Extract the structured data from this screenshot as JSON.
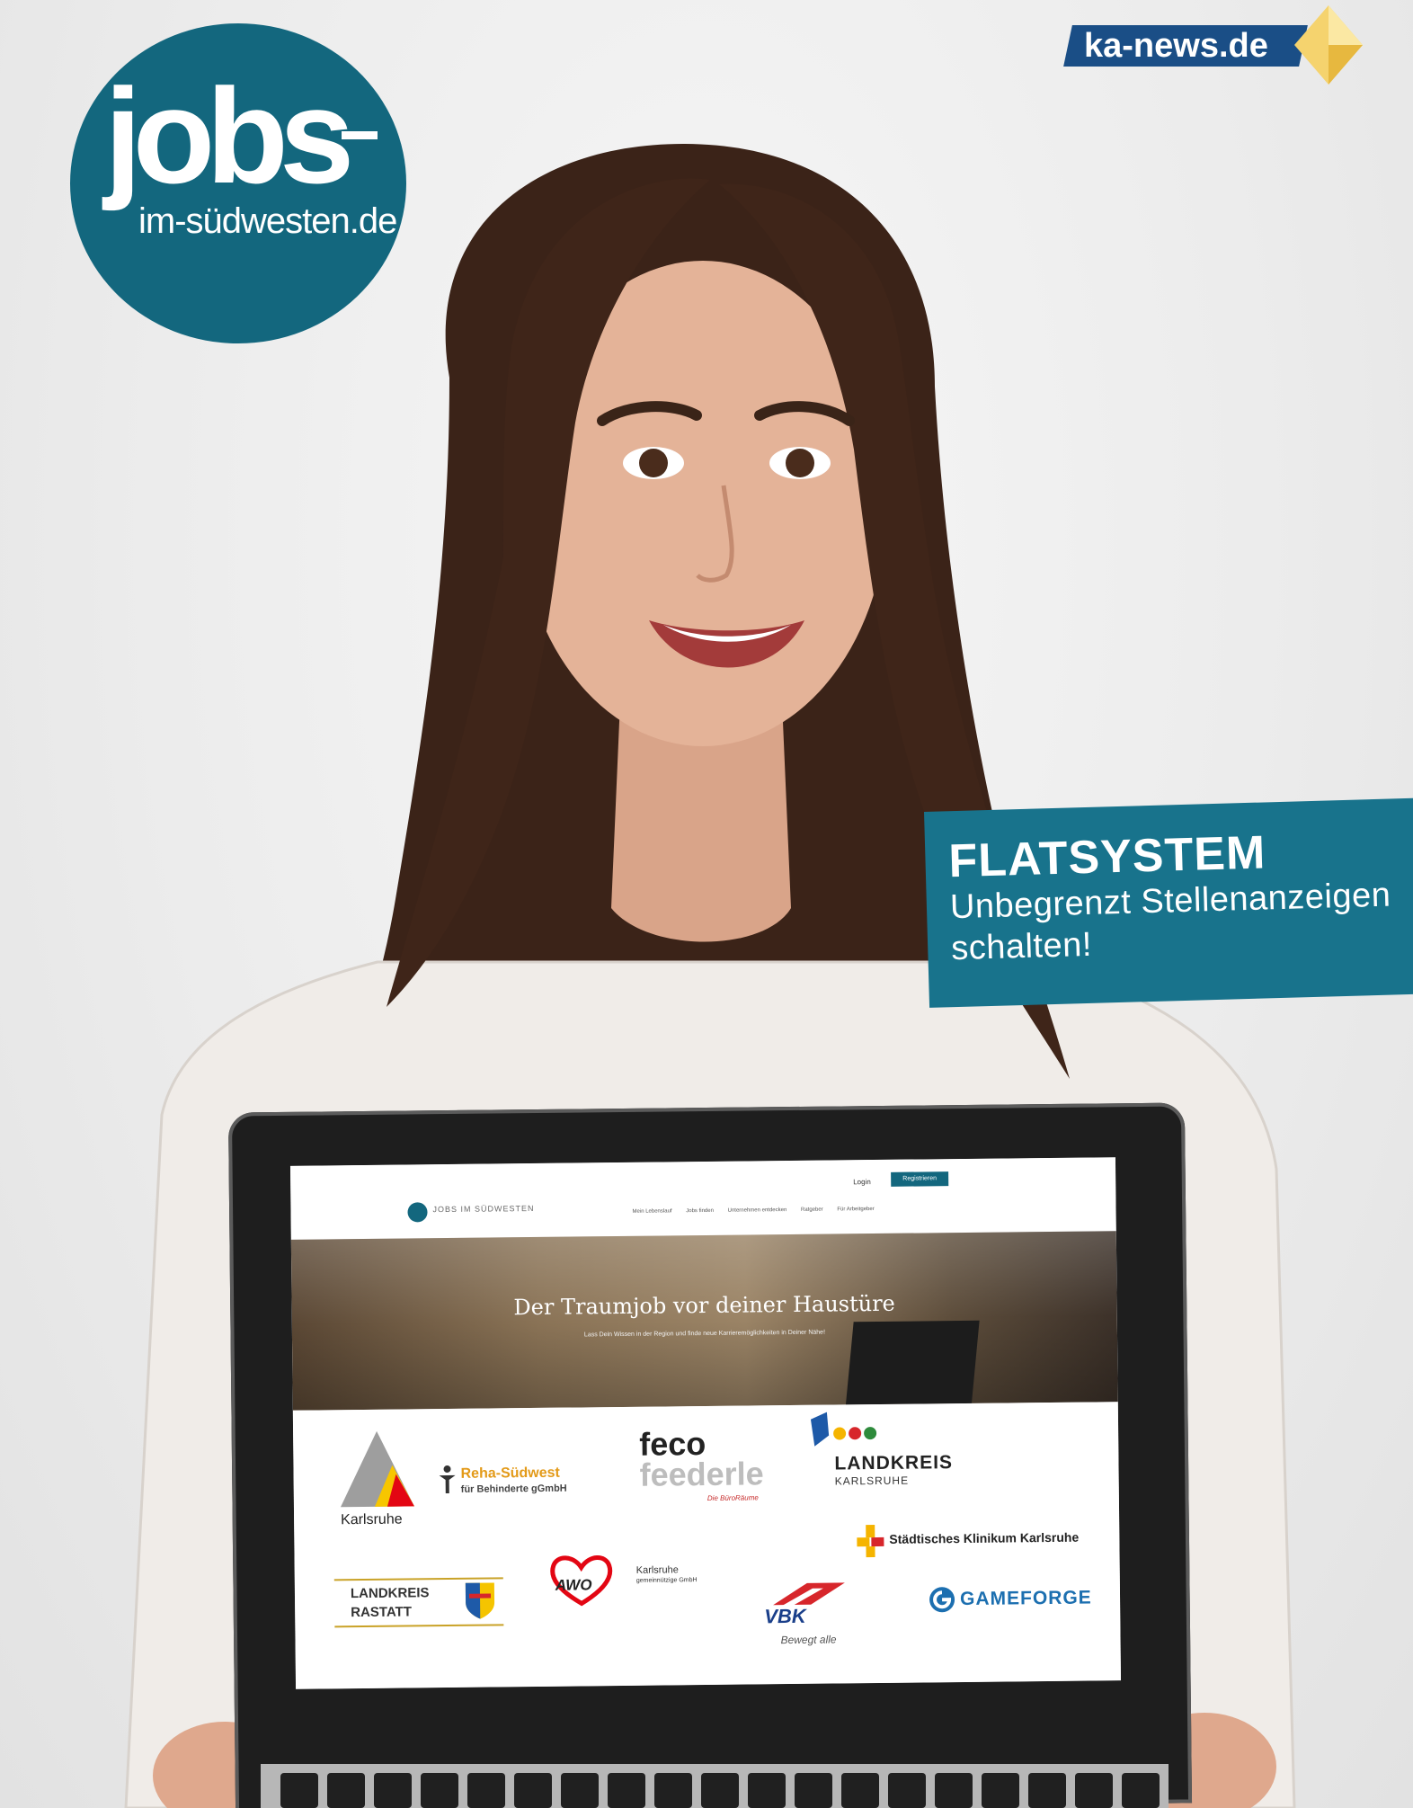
{
  "brand": {
    "jobs_logo_main": "jobs",
    "jobs_logo_sub": "im-südwesten.de",
    "ka_news": "ka-news.de",
    "primary_color": "#13677e",
    "ka_color": "#1a4e86"
  },
  "badge": {
    "title": "FLATSYSTEM",
    "line1": "Unbegrenzt Stellenanzeigen",
    "line2": "schalten!"
  },
  "screen": {
    "nav": {
      "brand": "JOBS IM SÜDWESTEN",
      "login": "Login",
      "register": "Registrieren",
      "menu": [
        "Mein Lebenslauf",
        "Jobs finden",
        "Unternehmen entdecken",
        "Ratgeber",
        "Für Arbeitgeber"
      ]
    },
    "hero": {
      "title": "Der Traumjob vor deiner Haustüre",
      "subtitle": "Lass Dein Wissen in der Region und finde neue Karrieremöglichkeiten in Deiner Nähe!"
    },
    "logos": {
      "karlsruhe": "Karlsruhe",
      "reha_a": "Reha-Südwest",
      "reha_b": "für Behinderte gGmbH",
      "feco_a": "feco",
      "feco_b": "feederle",
      "feco_c": "Die BüroRäume",
      "lkk_a": "LANDKREIS",
      "lkk_b": "KARLSRUHE",
      "klinikum": "Städtisches Klinikum Karlsruhe",
      "rastatt_a": "LANDKREIS",
      "rastatt_b": "RASTATT",
      "awo": "AWO",
      "awo_k": "Karlsruhe",
      "awo_g": "gemeinnützige GmbH",
      "vbk": "VBK",
      "vbk_s": "Bewegt alle",
      "gameforge": "GAMEFORGE"
    }
  }
}
